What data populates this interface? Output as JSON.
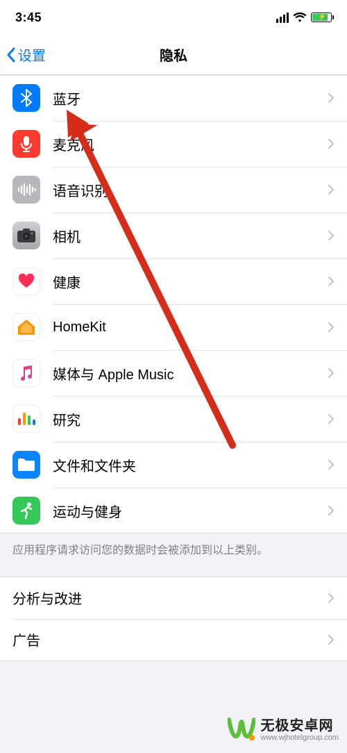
{
  "statusbar": {
    "time": "3:45"
  },
  "nav": {
    "back_label": "设置",
    "title": "隐私"
  },
  "rows": [
    {
      "id": "bluetooth",
      "label": "蓝牙",
      "icon": "bluetooth-icon",
      "bg": "#007aff"
    },
    {
      "id": "microphone",
      "label": "麦克风",
      "icon": "microphone-icon",
      "bg": "#ff3b30"
    },
    {
      "id": "speech",
      "label": "语音识别",
      "icon": "waveform-icon",
      "bg": "#8e8e93"
    },
    {
      "id": "camera",
      "label": "相机",
      "icon": "camera-icon",
      "bg": "#8e8e93"
    },
    {
      "id": "health",
      "label": "健康",
      "icon": "heart-icon",
      "bg": "#ffffff"
    },
    {
      "id": "homekit",
      "label": "HomeKit",
      "icon": "home-icon",
      "bg": "#ffffff"
    },
    {
      "id": "media",
      "label": "媒体与 Apple Music",
      "icon": "music-icon",
      "bg": "#ffffff"
    },
    {
      "id": "research",
      "label": "研究",
      "icon": "bars-icon",
      "bg": "#ffffff"
    },
    {
      "id": "files",
      "label": "文件和文件夹",
      "icon": "folder-icon",
      "bg": "#0a84ff"
    },
    {
      "id": "fitness",
      "label": "运动与健身",
      "icon": "runner-icon",
      "bg": "#34c759"
    }
  ],
  "footer_note": "应用程序请求访问您的数据时会被添加到以上类别。",
  "group2": [
    {
      "id": "analytics",
      "label": "分析与改进"
    },
    {
      "id": "ads",
      "label": "广告"
    }
  ],
  "watermark": {
    "line1": "无极安卓网",
    "line2": "www.wjhotelgroup.com"
  }
}
